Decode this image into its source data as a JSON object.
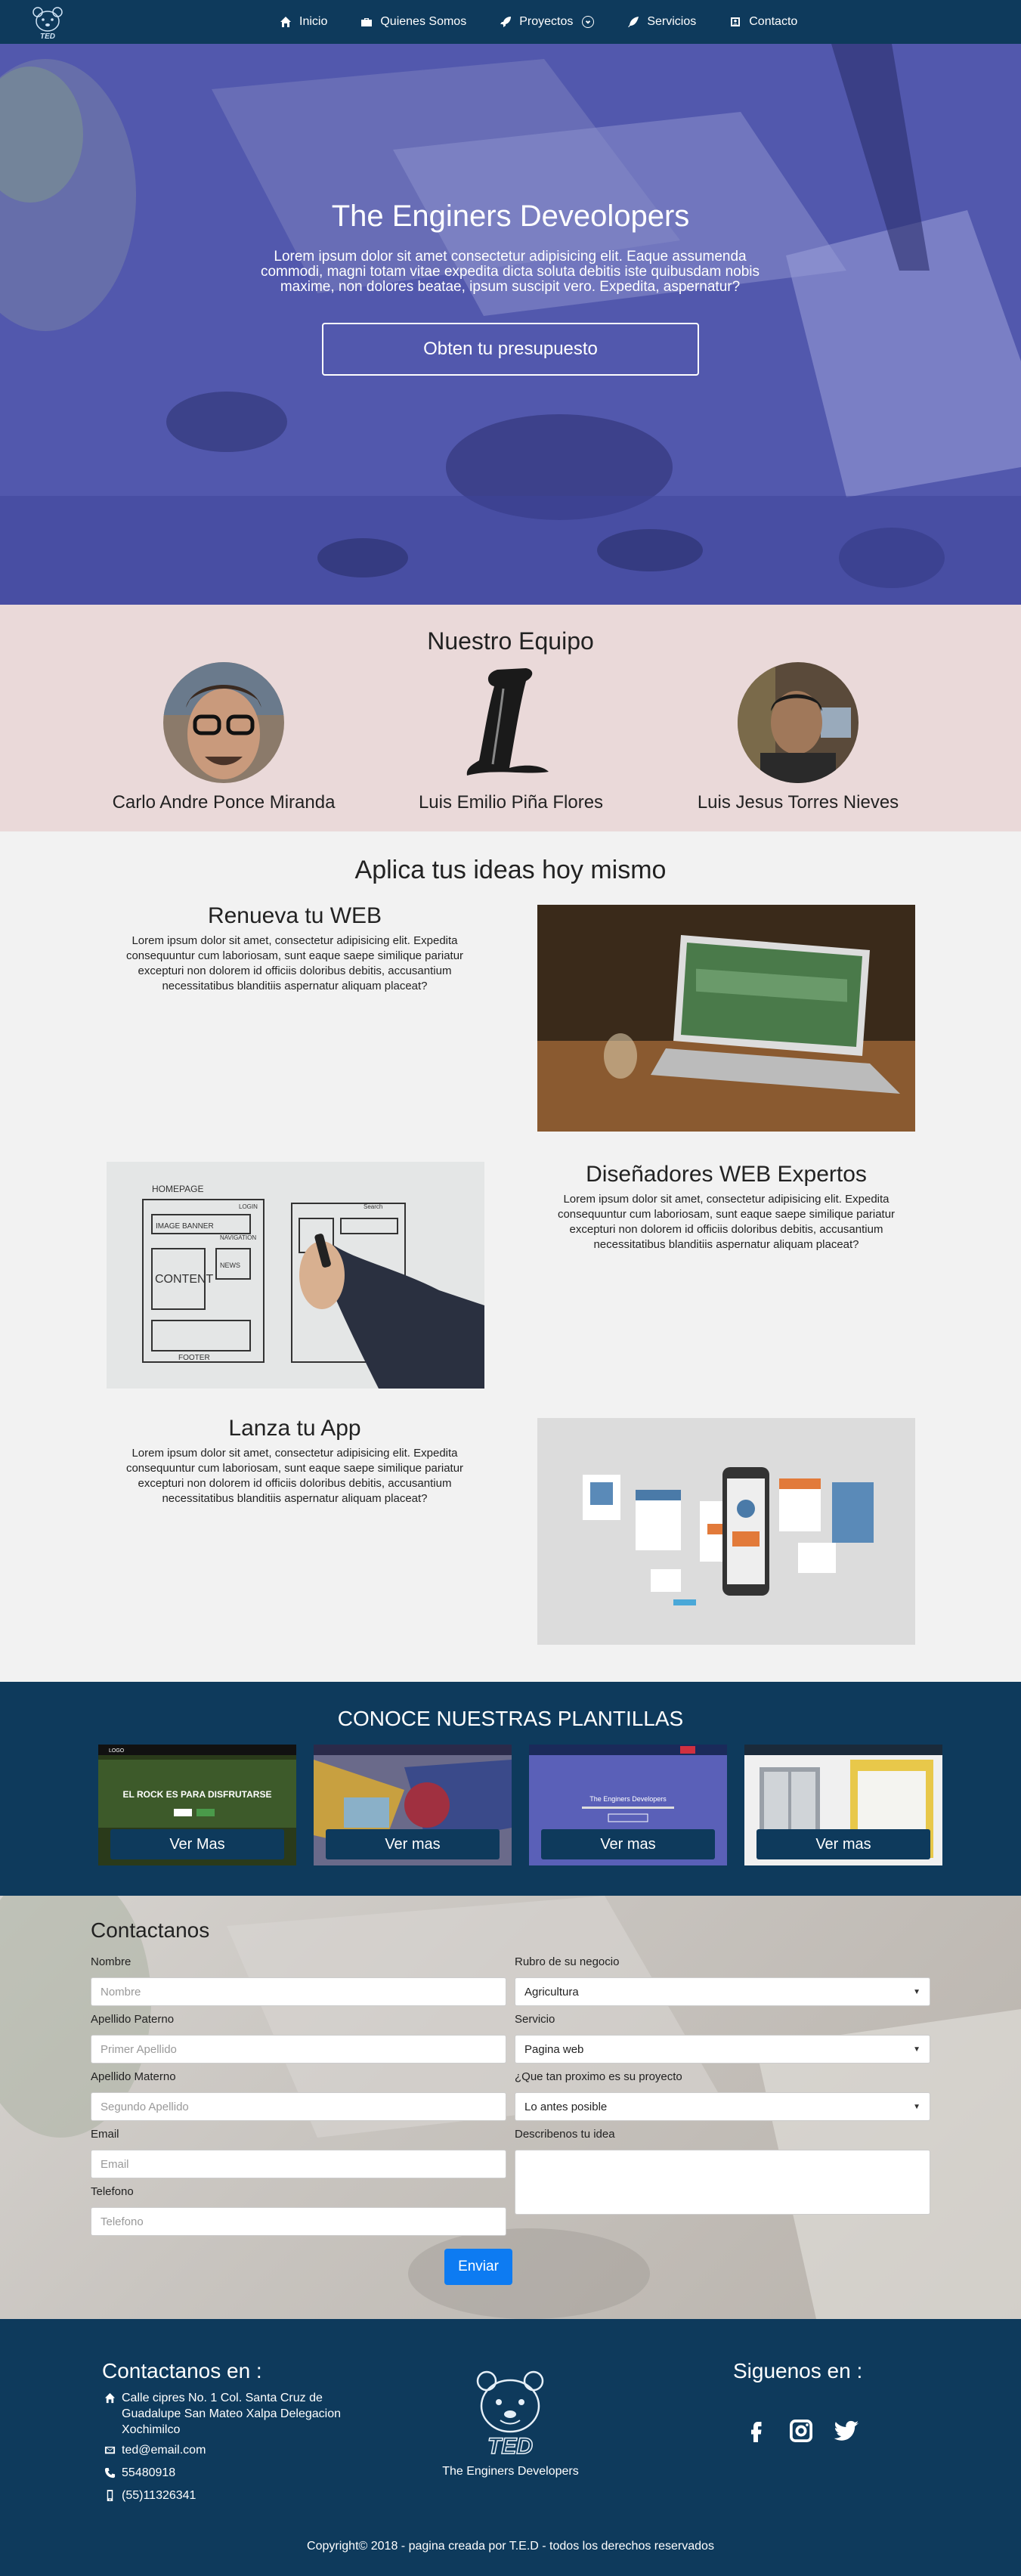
{
  "nav": {
    "items": [
      {
        "label": "Inicio",
        "icon": "home-icon"
      },
      {
        "label": "Quienes Somos",
        "icon": "briefcase-icon"
      },
      {
        "label": "Proyectos",
        "icon": "rocket-icon"
      },
      {
        "label": "Servicios",
        "icon": "feather-icon"
      },
      {
        "label": "Contacto",
        "icon": "contact-icon"
      }
    ]
  },
  "hero": {
    "title": "The Enginers Deveolopers",
    "subtitle": "Lorem ipsum dolor sit amet consectetur adipisicing elit. Eaque assumenda commodi, magni totam vitae expedita dicta soluta debitis iste quibusdam nobis maxime, non dolores beatae, ipsum suscipit vero. Expedita, aspernatur?",
    "button": "Obten tu presupuesto"
  },
  "team": {
    "title": "Nuestro Equipo",
    "members": [
      {
        "name": "Carlo Andre Ponce Miranda"
      },
      {
        "name": "Luis Emilio Piña Flores"
      },
      {
        "name": "Luis Jesus Torres Nieves"
      }
    ]
  },
  "ideas": {
    "title": "Aplica tus ideas hoy mismo",
    "features": [
      {
        "title": "Renueva tu WEB",
        "body": "Lorem ipsum dolor sit amet, consectetur adipisicing elit. Expedita consequuntur cum laboriosam, sunt eaque saepe similique pariatur excepturi non dolorem id officiis doloribus debitis, accusantium necessitatibus blanditiis aspernatur aliquam placeat?"
      },
      {
        "title": "Diseñadores WEB Expertos",
        "body": "Lorem ipsum dolor sit amet, consectetur adipisicing elit. Expedita consequuntur cum laboriosam, sunt eaque saepe similique pariatur excepturi non dolorem id officiis doloribus debitis, accusantium necessitatibus blanditiis aspernatur aliquam placeat?"
      },
      {
        "title": "Lanza tu App",
        "body": "Lorem ipsum dolor sit amet, consectetur adipisicing elit. Expedita consequuntur cum laboriosam, sunt eaque saepe similique pariatur excepturi non dolorem id officiis doloribus debitis, accusantium necessitatibus blanditiis aspernatur aliquam placeat?"
      }
    ],
    "sketch_words": [
      "HOMEPAGE",
      "IMAGE BANNER",
      "CONTENT",
      "NEWS",
      "FOOTER",
      "NAVIGATION"
    ],
    "sketch_tags": [
      "LOGIN",
      "Search"
    ]
  },
  "templates": {
    "title": "CONOCE NUESTRAS PLANTILLAS",
    "items": [
      {
        "button": "Ver Mas",
        "headline": "EL ROCK ES PARA DISFRUTARSE",
        "logo": "LOGO"
      },
      {
        "button": "Ver mas",
        "headline": "",
        "logo": ""
      },
      {
        "button": "Ver mas",
        "headline": "The Enginers Developers",
        "logo": ""
      },
      {
        "button": "Ver mas",
        "headline": "",
        "logo": ""
      }
    ]
  },
  "contact": {
    "title": "Contactanos",
    "left_fields": [
      {
        "label": "Nombre",
        "placeholder": "Nombre"
      },
      {
        "label": "Apellido Paterno",
        "placeholder": "Primer Apellido"
      },
      {
        "label": "Apellido Materno",
        "placeholder": "Segundo Apellido"
      },
      {
        "label": "Email",
        "placeholder": "Email"
      },
      {
        "label": "Telefono",
        "placeholder": "Telefono"
      }
    ],
    "right_selects": [
      {
        "label": "Rubro de su negocio",
        "value": "Agricultura"
      },
      {
        "label": "Servicio",
        "value": "Pagina web"
      },
      {
        "label": "¿Que tan proximo es su proyecto",
        "value": "Lo antes posible"
      }
    ],
    "textarea_label": "Describenos tu idea",
    "submit": "Enviar"
  },
  "footer": {
    "contact_title": "Contactanos en :",
    "address": "Calle cipres No. 1 Col. Santa Cruz de Guadalupe San Mateo Xalpa Delegacion Xochimilco",
    "email": "ted@email.com",
    "phone": "55480918",
    "mobile": "(55)11326341",
    "logo_text": "TED",
    "brand": "The Enginers Developers",
    "social_title": "Siguenos en :",
    "copyright": "Copyright© 2018 - pagina creada por T.E.D - todos los derechos reservados"
  },
  "colors": {
    "navy": "#0e3a5c",
    "hero_overlay": "#4a50aa",
    "team_bg": "#ead9d9",
    "button_blue": "#0d7bf2"
  }
}
